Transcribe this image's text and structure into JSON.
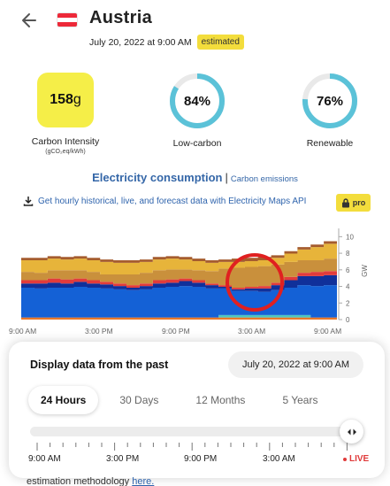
{
  "header": {
    "country": "Austria",
    "datetime": "July 20, 2022 at 9:00 AM",
    "badge": "estimated",
    "flag_colors": [
      "#ed2939",
      "#ffffff",
      "#ed2939"
    ]
  },
  "metrics": {
    "carbon_intensity": {
      "value": "158",
      "unit": "g",
      "label": "Carbon Intensity",
      "sublabel": "(gCO₂eq/kWh)"
    },
    "low_carbon": {
      "value": "84%",
      "fraction": 0.84,
      "label": "Low-carbon"
    },
    "renewable": {
      "value": "76%",
      "fraction": 0.76,
      "label": "Renewable"
    }
  },
  "tabs": {
    "active": "Electricity consumption",
    "separator": "|",
    "inactive": "Carbon emissions"
  },
  "promo": {
    "link_text": "Get hourly historical, live, and forecast data with Electricity Maps API",
    "badge": "pro"
  },
  "chart_data": {
    "type": "area",
    "stacked": true,
    "ylabel": "GW",
    "y_ticks": [
      "0",
      "2",
      "4",
      "6",
      "8",
      "10"
    ],
    "ylim": [
      0,
      11
    ],
    "x_tick_labels": [
      "9:00 AM",
      "3:00 PM",
      "9:00 PM",
      "3:00 AM",
      "9:00 AM"
    ],
    "series_colors": [
      "#e8782a",
      "#1461d6",
      "#10309a",
      "#e23b3b",
      "#c9903c",
      "#e7b43a",
      "#a55c2e",
      "#4ec6c0"
    ],
    "highlight_region": "around 3:00 AM"
  },
  "panel": {
    "title": "Display data from the past",
    "date": "July 20, 2022 at 9:00 AM",
    "ranges": [
      "24 Hours",
      "30 Days",
      "12 Months",
      "5 Years"
    ],
    "active_range": "24 Hours",
    "slider_labels": [
      "9:00 AM",
      "3:00 PM",
      "9:00 PM",
      "3:00 AM"
    ],
    "live": "LIVE"
  },
  "footer": {
    "text": "estimation methodology ",
    "link": "here."
  }
}
